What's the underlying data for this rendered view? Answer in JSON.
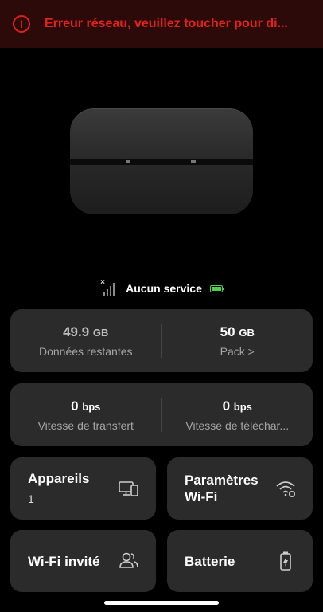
{
  "error_banner": {
    "text": "Erreur réseau, veuillez toucher pour di...",
    "icon": "exclamation-circle-icon",
    "color": "#e2231a"
  },
  "status": {
    "service_text": "Aucun service",
    "signal_icon": "no-signal-icon",
    "battery_icon": "battery-icon",
    "battery_color": "#4bd04b"
  },
  "data_card": {
    "remaining_value": "49.9",
    "remaining_unit": "GB",
    "remaining_label": "Données restantes",
    "pack_value": "50",
    "pack_unit": "GB",
    "pack_label": "Pack >"
  },
  "speed_card": {
    "upload_value": "0",
    "upload_unit": "bps",
    "upload_label": "Vitesse de transfert",
    "download_value": "0",
    "download_unit": "bps",
    "download_label": "Vitesse de téléchar..."
  },
  "tiles": {
    "devices": {
      "title": "Appareils",
      "count": "1",
      "icon": "devices-icon"
    },
    "wifi_settings": {
      "title_line1": "Paramètres",
      "title_line2": "Wi-Fi",
      "icon": "wifi-settings-icon"
    },
    "guest_wifi": {
      "title": "Wi-Fi invité",
      "icon": "guest-users-icon"
    },
    "battery": {
      "title": "Batterie",
      "icon": "battery-charging-icon"
    }
  }
}
